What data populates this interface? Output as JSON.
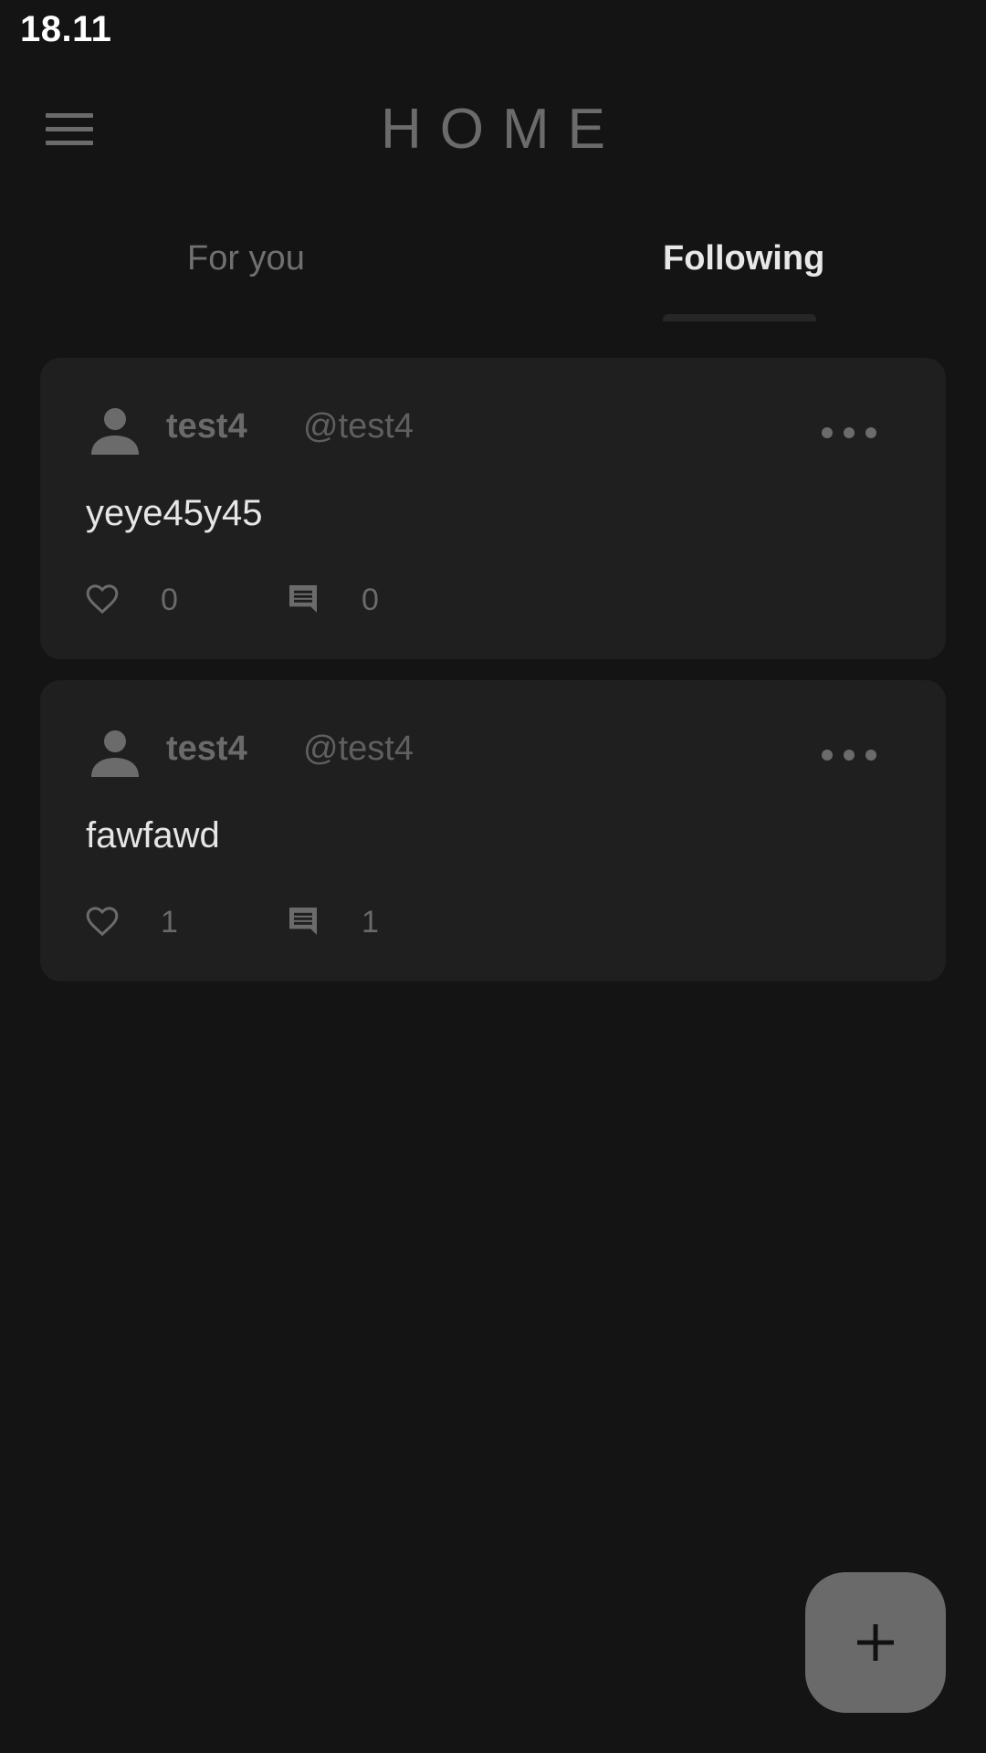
{
  "status_bar": {
    "time": "18.11"
  },
  "app_bar": {
    "title": "HOME",
    "menu_icon": "hamburger-menu-icon"
  },
  "tabs": [
    {
      "label": "For you",
      "selected": false
    },
    {
      "label": "Following",
      "selected": true
    }
  ],
  "posts": [
    {
      "author": "test4",
      "handle": "@test4",
      "text": "yeye45y45",
      "likes": "0",
      "comments": "0"
    },
    {
      "author": "test4",
      "handle": "@test4",
      "text": "fawfawd",
      "likes": "1",
      "comments": "1"
    }
  ],
  "icons": {
    "avatar": "person-icon",
    "more": "more-horizontal-icon",
    "like": "heart-outline-icon",
    "comment": "comment-icon",
    "fab": "plus-icon"
  },
  "colors": {
    "background": "#141414",
    "card": "#1f1f1f",
    "muted_text": "#6a6a6a",
    "primary_text": "#e6e6e6",
    "fab": "#6a6a6a"
  }
}
